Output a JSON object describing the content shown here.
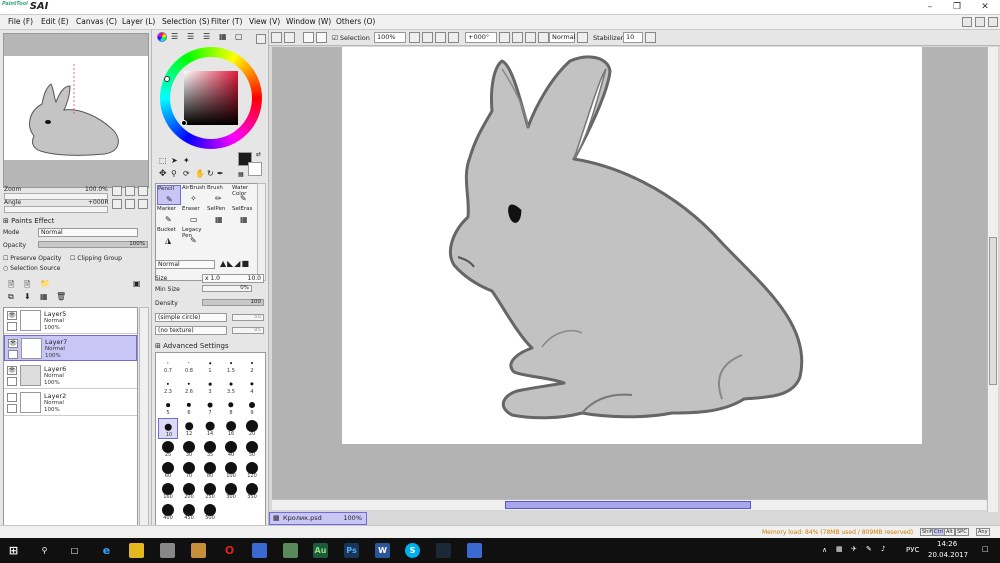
{
  "app": {
    "logo_prefix": "PaintTool",
    "logo_name": "SAI"
  },
  "menus": [
    "File (F)",
    "Edit (E)",
    "Canvas (C)",
    "Layer (L)",
    "Selection (S)",
    "Filter (T)",
    "View (V)",
    "Window (W)",
    "Others (O)"
  ],
  "navigator": {
    "zoom_label": "Zoom",
    "zoom_value": "100.0%",
    "angle_label": "Angle",
    "angle_value": "+000R"
  },
  "layer_props": {
    "paints_effect": "Paints Effect",
    "mode_label": "Mode",
    "mode_value": "Normal",
    "opacity_label": "Opacity",
    "opacity_value": "100%",
    "preserve_opacity": "Preserve Opacity",
    "clipping_group": "Clipping Group",
    "selection_source": "Selection Source"
  },
  "layers": [
    {
      "name": "Layer5",
      "mode": "Normal",
      "opacity": "100%",
      "selected": false,
      "visible": true
    },
    {
      "name": "Layer7",
      "mode": "Normal",
      "opacity": "100%",
      "selected": true,
      "visible": true
    },
    {
      "name": "Layer6",
      "mode": "Normal",
      "opacity": "100%",
      "selected": false,
      "visible": true
    },
    {
      "name": "Layer2",
      "mode": "Normal",
      "opacity": "100%",
      "selected": false,
      "visible": false
    }
  ],
  "tools": [
    {
      "label": "Pencil",
      "selected": true
    },
    {
      "label": "AirBrush",
      "selected": false
    },
    {
      "label": "Brush",
      "selected": false
    },
    {
      "label": "Water Color",
      "selected": false
    },
    {
      "label": "Marker",
      "selected": false
    },
    {
      "label": "Eraser",
      "selected": false
    },
    {
      "label": "SelPen",
      "selected": false
    },
    {
      "label": "SelEras",
      "selected": false
    },
    {
      "label": "Bucket",
      "selected": false
    },
    {
      "label": "Legacy Pen",
      "selected": false
    }
  ],
  "brush": {
    "blend_mode": "Normal",
    "size_label": "Size",
    "size_mult": "x 1.0",
    "size_value": "10.0",
    "min_size_label": "Min Size",
    "min_size_value": "0%",
    "density_label": "Density",
    "density_value": "100",
    "shape": "(simple circle)",
    "shape_value": "50",
    "texture": "(no texture)",
    "texture_value": "95",
    "advanced_label": "Advanced Settings"
  },
  "brush_sizes": [
    "0.7",
    "0.8",
    "1",
    "1.5",
    "2",
    "2.3",
    "2.6",
    "3",
    "3.5",
    "4",
    "5",
    "6",
    "7",
    "8",
    "9",
    "10",
    "12",
    "14",
    "16",
    "20",
    "25",
    "30",
    "35",
    "40",
    "50",
    "60",
    "70",
    "80",
    "100",
    "120",
    "160",
    "200",
    "250",
    "300",
    "350",
    "400",
    "450",
    "500"
  ],
  "selected_brush_size": "10",
  "canvas_toolbar": {
    "selection_label": "Selection",
    "zoom": "100%",
    "angle": "+000°",
    "blend": "Normal",
    "stabilizer_label": "Stabilizer",
    "stabilizer_value": "10"
  },
  "document": {
    "tab_name": "Кролик.psd",
    "tab_zoom": "100%"
  },
  "status": {
    "memory": "Memory load: 84% (78MB used / 809MB reserved)",
    "keys": [
      "Shift",
      "Ctrl",
      "Alt",
      "SPC",
      "Any"
    ]
  },
  "taskbar": {
    "lang": "РУС",
    "time": "14:26",
    "date": "20.04.2017"
  },
  "colors": {
    "selection_highlight": "#c9c6f5",
    "selection_border": "#6f6bd8",
    "memory_text": "#d07a00",
    "foreground_color": "#1a1a1a"
  }
}
